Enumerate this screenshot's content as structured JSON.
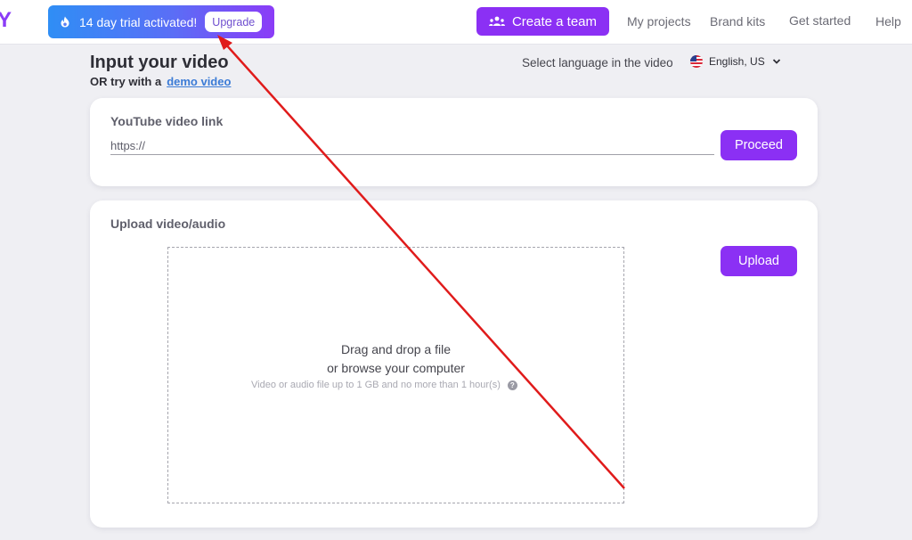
{
  "header": {
    "logo_fragment": "Y",
    "trial_banner": {
      "icon": "fire-icon",
      "text": "14 day trial activated!",
      "upgrade_label": "Upgrade"
    },
    "create_team": {
      "icon": "team-icon",
      "label": "Create a team"
    },
    "nav": [
      {
        "label": "My projects"
      },
      {
        "label": "Brand kits"
      },
      {
        "label": "Get started"
      },
      {
        "label": "Help"
      }
    ]
  },
  "main": {
    "title": "Input your video",
    "subtitle_prefix": "OR try with a",
    "demo_link": "demo video",
    "language": {
      "label": "Select language in the video",
      "flag_icon": "us-flag-icon",
      "selected": "English, US"
    },
    "youtube": {
      "label": "YouTube video link",
      "value": "",
      "placeholder": "https://",
      "button": "Proceed"
    },
    "upload": {
      "label": "Upload video/audio",
      "button": "Upload",
      "dropzone_line1": "Drag and drop a file",
      "dropzone_line2": "or browse your computer",
      "hint": "Video or audio file up to 1 GB and no more than 1 hour(s)",
      "help_glyph": "?"
    }
  },
  "colors": {
    "brand_purple": "#8b30f4",
    "banner_gradient_start": "#2f8ef5",
    "banner_gradient_end": "#8b3cf7",
    "link_blue": "#3b7bd6",
    "annotation_red": "#e01b1b",
    "page_bg": "#efeff3"
  }
}
